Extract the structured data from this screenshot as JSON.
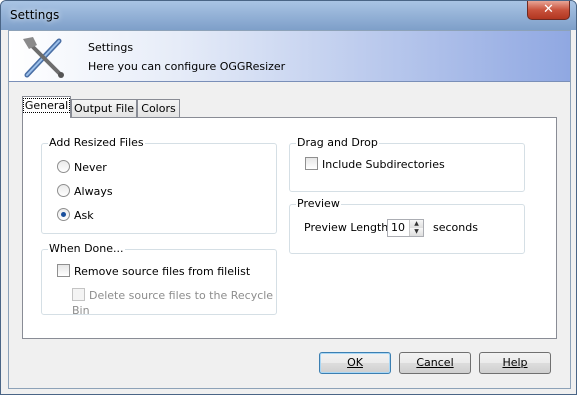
{
  "window": {
    "title": "Settings",
    "close_symbol": "✕"
  },
  "banner": {
    "title": "Settings",
    "subtitle": "Here you can configure OGGResizer",
    "icon": "tools-icon"
  },
  "tabs": [
    {
      "label": "General"
    },
    {
      "label": "Output File"
    },
    {
      "label": "Colors"
    }
  ],
  "general": {
    "add_resized": {
      "title": "Add Resized Files",
      "options": [
        {
          "label": "Never",
          "selected": false
        },
        {
          "label": "Always",
          "selected": false
        },
        {
          "label": "Ask",
          "selected": true
        }
      ]
    },
    "when_done": {
      "title": "When Done...",
      "remove_source": "Remove source files from filelist",
      "delete_source": "Delete source files to the Recycle Bin"
    },
    "drag_drop": {
      "title": "Drag and Drop",
      "include_subdirs": "Include Subdirectories"
    },
    "preview": {
      "title": "Preview",
      "length_label": "Preview Length:",
      "length_value": "10",
      "unit": "seconds"
    }
  },
  "buttons": {
    "ok": "OK",
    "cancel": "Cancel",
    "help": "Help"
  }
}
